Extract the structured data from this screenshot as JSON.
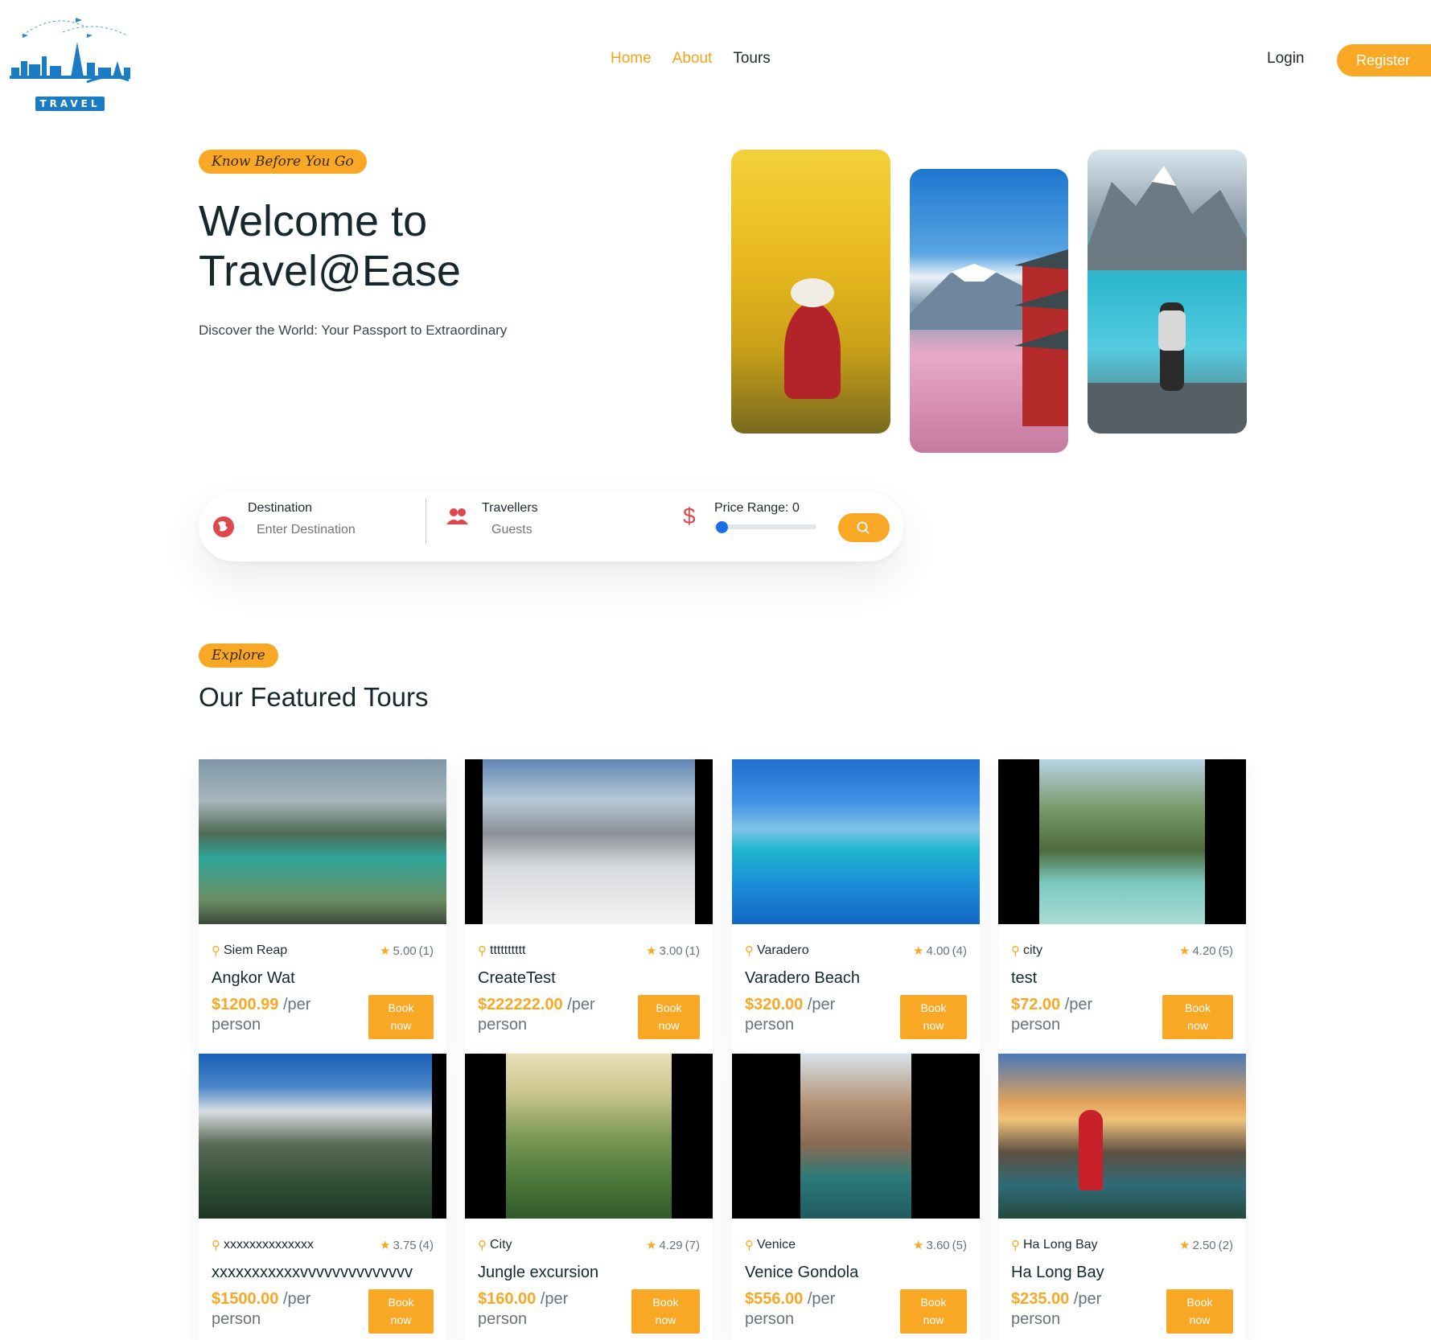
{
  "header": {
    "logo_text": "TRAVEL",
    "nav": [
      {
        "label": "Home"
      },
      {
        "label": "About"
      },
      {
        "label": "Tours"
      }
    ],
    "login_label": "Login",
    "register_label": "Register"
  },
  "hero": {
    "tagline": "Know Before You Go",
    "title_line1": "Welcome to",
    "title_line2": "Travel@Ease",
    "subtitle": "Discover the World: Your Passport to Extraordinary"
  },
  "search": {
    "destination_label": "Destination",
    "destination_placeholder": "Enter Destination",
    "travellers_label": "Travellers",
    "travellers_placeholder": "Guests",
    "price_label": "Price Range: 0",
    "price_value": 0
  },
  "featured": {
    "tag": "Explore",
    "title": "Our Featured Tours",
    "book_label_line1": "Book",
    "book_label_line2": "now",
    "per_label_line1": "/per",
    "per_label_line2": "person",
    "tours": [
      {
        "location": "Siem Reap",
        "rating": "5.00",
        "reviews": "(1)",
        "title": "Angkor Wat",
        "price": "$1200.99"
      },
      {
        "location": "tttttttttt",
        "rating": "3.00",
        "reviews": "(1)",
        "title": "CreateTest",
        "price": "$222222.00"
      },
      {
        "location": "Varadero",
        "rating": "4.00",
        "reviews": "(4)",
        "title": "Varadero Beach",
        "price": "$320.00"
      },
      {
        "location": "city",
        "rating": "4.20",
        "reviews": "(5)",
        "title": "test",
        "price": "$72.00"
      },
      {
        "location": "xxxxxxxxxxxxxx",
        "rating": "3.75",
        "reviews": "(4)",
        "title": "xxxxxxxxxxxvvvvvvvvvvvvvv",
        "price": "$1500.00"
      },
      {
        "location": "City",
        "rating": "4.29",
        "reviews": "(7)",
        "title": "Jungle excursion",
        "price": "$160.00"
      },
      {
        "location": "Venice",
        "rating": "3.60",
        "reviews": "(5)",
        "title": "Venice Gondola",
        "price": "$556.00"
      },
      {
        "location": "Ha Long Bay",
        "rating": "2.50",
        "reviews": "(2)",
        "title": "Ha Long Bay",
        "price": "$235.00"
      }
    ]
  },
  "colors": {
    "accent": "#f9a825",
    "heading": "#17282c",
    "slider": "#1a6ee6",
    "icon_red": "#e0474c",
    "logo_blue": "#1b7cc4"
  }
}
